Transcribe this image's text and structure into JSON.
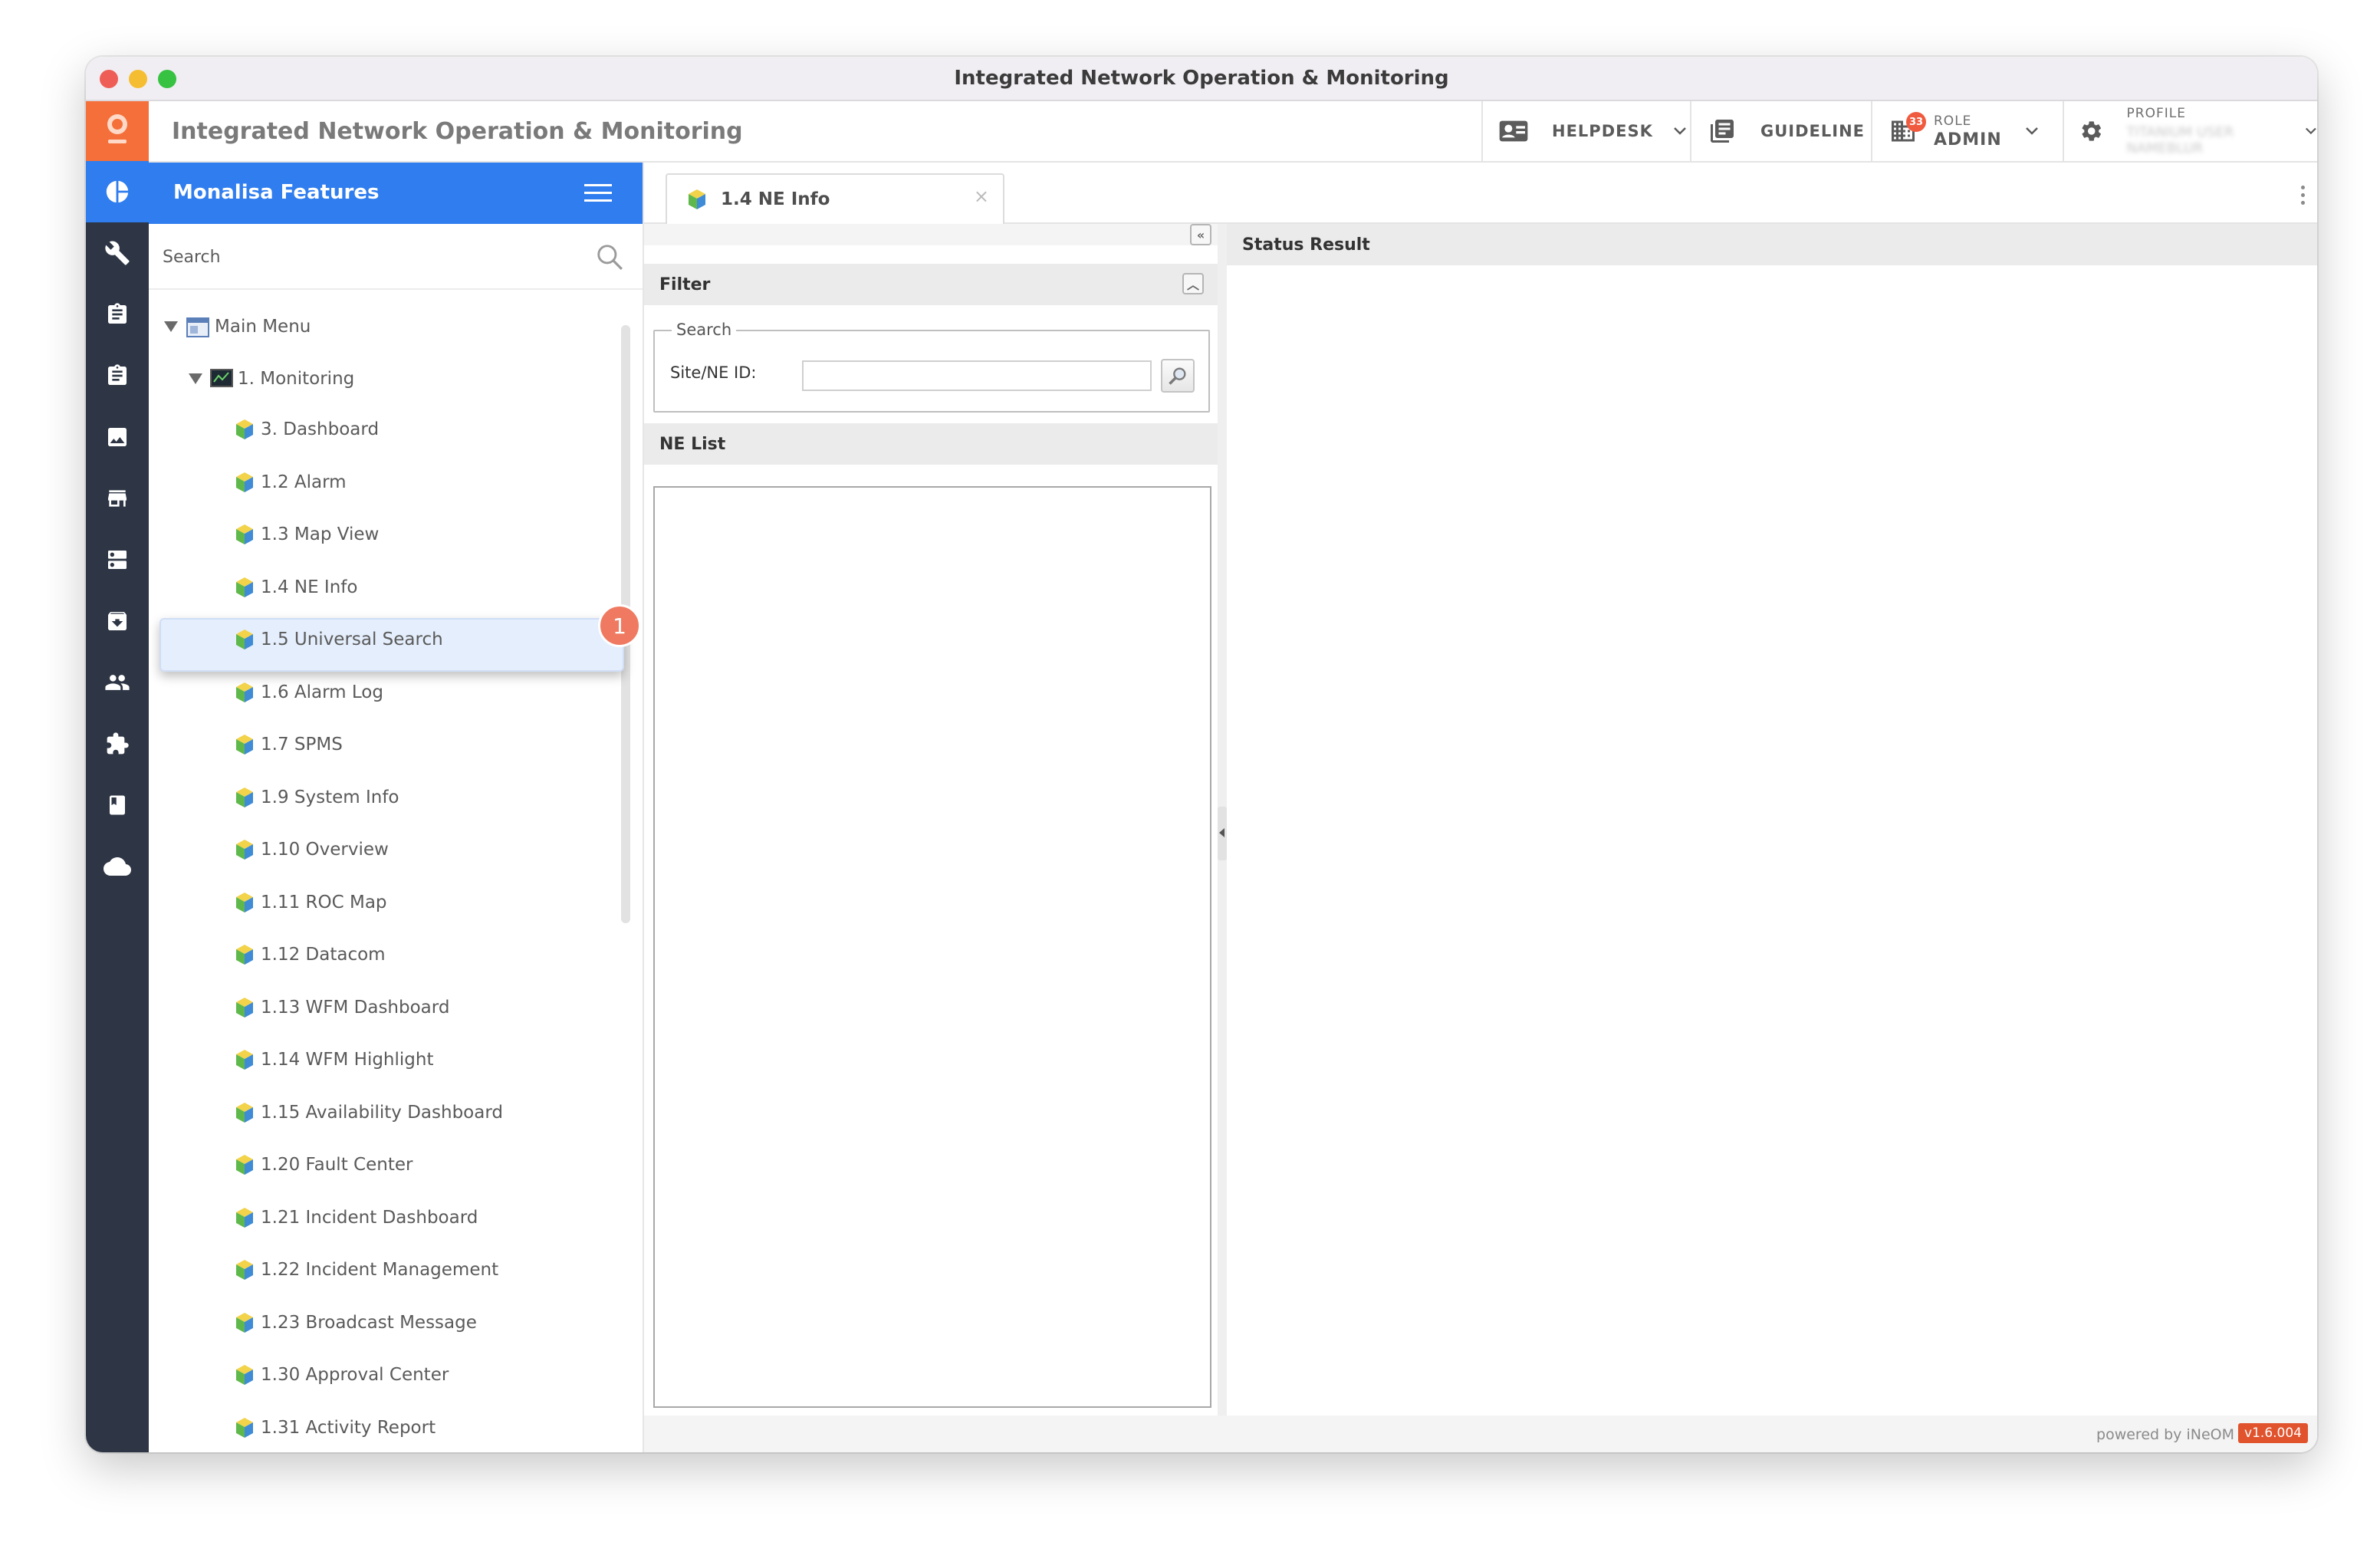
{
  "window": {
    "title": "Integrated Network Operation & Monitoring"
  },
  "header": {
    "app_title": "Integrated Network Operation & Monitoring",
    "helpdesk": "HELPDESK",
    "guideline": "GUIDELINE",
    "notification_count": "33",
    "role_label": "ROLE",
    "role_value": "ADMIN",
    "profile_label": "PROFILE",
    "profile_value": "TITANIUM USER NAMEBLUR"
  },
  "sidebar": {
    "title": "Monalisa Features",
    "search_placeholder": "Search",
    "root": "Main Menu",
    "group": "1. Monitoring",
    "items": [
      "3. Dashboard",
      "1.2 Alarm",
      "1.3 Map View",
      "1.4 NE Info",
      "1.5 Universal Search",
      "1.6 Alarm Log",
      "1.7 SPMS",
      "1.9 System Info",
      "1.10 Overview",
      "1.11 ROC Map",
      "1.12 Datacom",
      "1.13 WFM Dashboard",
      "1.14 WFM Highlight",
      "1.15 Availability Dashboard",
      "1.20 Fault Center",
      "1.21 Incident Dashboard",
      "1.22 Incident Management",
      "1.23 Broadcast Message",
      "1.30 Approval Center",
      "1.31 Activity Report"
    ],
    "selected_badge": "1"
  },
  "tabs": [
    {
      "label": "1.4 NE Info",
      "close": "×"
    }
  ],
  "left_panel": {
    "filter_title": "Filter",
    "search_legend": "Search",
    "field_label": "Site/NE ID:",
    "field_value": "",
    "list_title": "NE List"
  },
  "right_panel": {
    "title": "Status Result"
  },
  "footer": {
    "powered": "powered by iNeOM",
    "version": "v1.6.004"
  },
  "colors": {
    "accent": "#2f7dee",
    "logo": "#f46f3a",
    "rail": "#2e3645",
    "badge": "#ef7a61"
  }
}
